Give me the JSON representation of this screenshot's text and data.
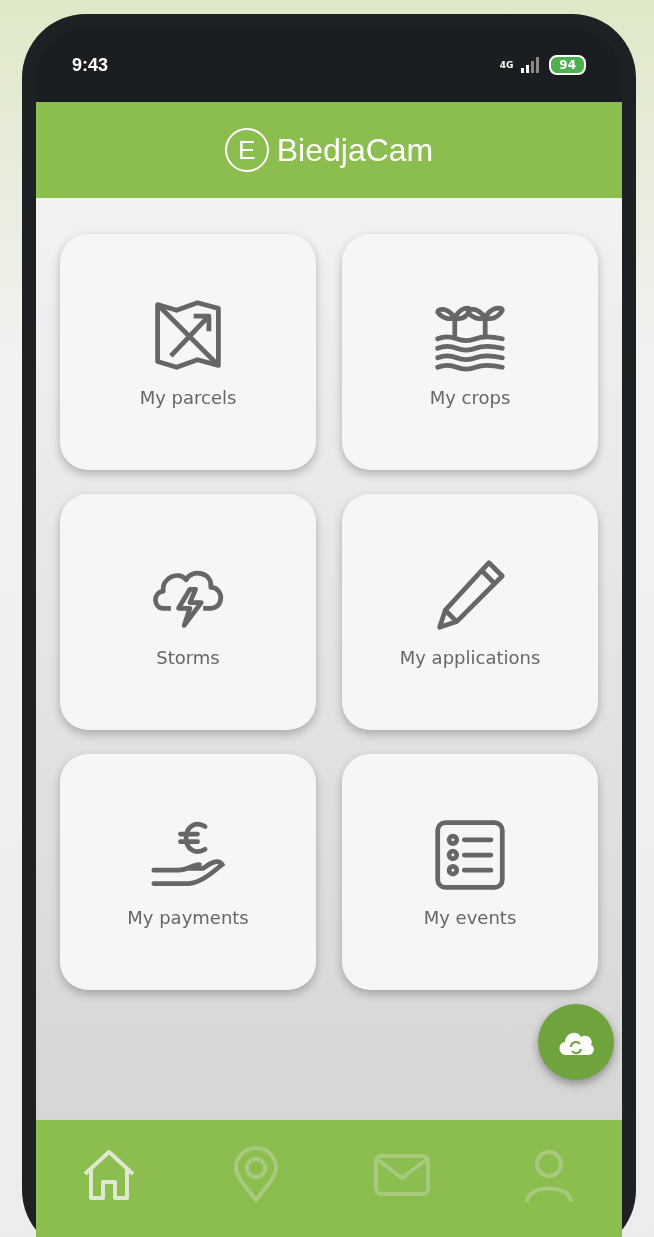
{
  "status_bar": {
    "time": "9:43",
    "network": "4G",
    "battery": "94"
  },
  "header": {
    "logo_letter": "E",
    "title": "BiedjaCam"
  },
  "tiles": [
    {
      "label": "My parcels",
      "kind": "map"
    },
    {
      "label": "My crops",
      "kind": "crops"
    },
    {
      "label": "Storms",
      "kind": "storm"
    },
    {
      "label": "My applications",
      "kind": "pencil"
    },
    {
      "label": "My payments",
      "kind": "payment"
    },
    {
      "label": "My events",
      "kind": "list"
    }
  ],
  "nav": [
    {
      "kind": "home"
    },
    {
      "kind": "pin"
    },
    {
      "kind": "mail"
    },
    {
      "kind": "person"
    }
  ]
}
